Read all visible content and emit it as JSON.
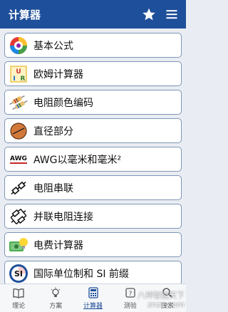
{
  "app_bar": {
    "title": "计算器",
    "bg_color": "#1e4f9a",
    "star_icon": "star-icon",
    "menu_icon": "hamburger-menu-icon"
  },
  "list": {
    "items": [
      {
        "label": "基本公式",
        "icon": "color-wheel-icon"
      },
      {
        "label": "欧姆计算器",
        "icon": "ohm-triangle-icon"
      },
      {
        "label": "电阻颜色编码",
        "icon": "resistor-color-icon"
      },
      {
        "label": "直径部分",
        "icon": "wire-diameter-icon"
      },
      {
        "label": "AWG以毫米和毫米²",
        "icon": "awg-icon",
        "icon_text": "AWG"
      },
      {
        "label": "电阻串联",
        "icon": "series-resistor-icon"
      },
      {
        "label": "并联电阻连接",
        "icon": "parallel-resistor-icon"
      },
      {
        "label": "电费计算器",
        "icon": "electricity-bill-icon"
      },
      {
        "label": "国际单位制和 SI 前缀",
        "icon": "si-units-icon",
        "icon_text": "SI"
      }
    ]
  },
  "bottom_nav": {
    "items": [
      {
        "label": "理论",
        "icon": "book-icon"
      },
      {
        "label": "方案",
        "icon": "lightbulb-icon"
      },
      {
        "label": "计算器",
        "icon": "calculator-icon",
        "active": true
      },
      {
        "label": "测验",
        "icon": "quiz-icon"
      },
      {
        "label": "搜索",
        "icon": "search-icon"
      }
    ]
  },
  "watermark": {
    "line1": "八神智能天下",
    "line2": "znzx.com"
  }
}
